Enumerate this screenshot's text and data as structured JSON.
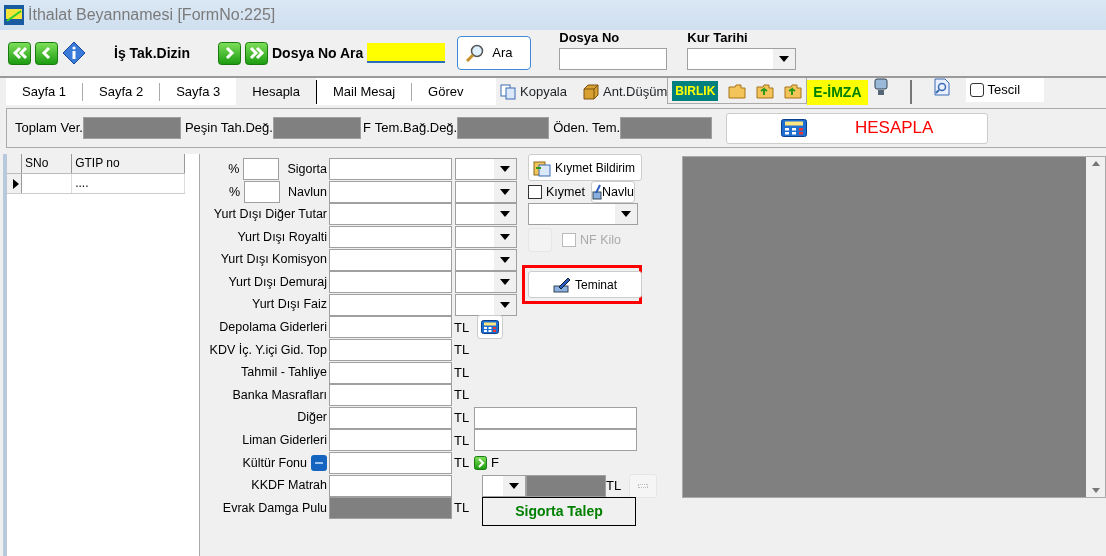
{
  "window": {
    "title": "İthalat Beyannamesi [FormNo:225]"
  },
  "toolbar": {
    "index_label": "İş Tak.Dizin",
    "search_label": "Dosya No Ara",
    "search_field": {
      "highlighted": true
    },
    "search_button": "Ara",
    "file_no_label": "Dosya No",
    "rate_date_label": "Kur Tarihi"
  },
  "tabs": [
    {
      "label": "Sayfa 1",
      "selected": false
    },
    {
      "label": "Sayfa 2",
      "selected": false
    },
    {
      "label": "Sayfa 3",
      "selected": false
    },
    {
      "label": "Hesapla",
      "selected": true
    },
    {
      "label": "Mail Mesaj",
      "selected": false
    },
    {
      "label": "Görev",
      "selected": false
    }
  ],
  "tools": {
    "copy": "Kopyala",
    "deduction": "Ant.Düşüm",
    "birlik": "BIRLIK",
    "esign": "E-İMZA",
    "register": {
      "label": "Tescil",
      "checked": false
    }
  },
  "summary": {
    "fields": [
      {
        "label": "Toplam Ver.",
        "disabled": true
      },
      {
        "label": "Peşin Tah.Değ.",
        "disabled": true,
        "suffix": "F"
      },
      {
        "label": "Tem.Bağ.Değ.",
        "disabled": true
      },
      {
        "label": "Öden. Tem.",
        "disabled": true
      }
    ],
    "calc_button": "HESAPLA"
  },
  "grid": {
    "columns": [
      "SNo",
      "GTIP no"
    ],
    "rows": [
      {
        "current": true,
        "cells": [
          "",
          "...."
        ]
      }
    ]
  },
  "form": {
    "top_rows": [
      {
        "label": "Sigorta",
        "prefix": "%"
      },
      {
        "label": "Navlun",
        "prefix": "%"
      },
      {
        "label": "Yurt Dışı Diğer Tutar"
      },
      {
        "label": "Yurt Dışı Royalti"
      },
      {
        "label": "Yurt Dışı Komisyon"
      },
      {
        "label": "Yurt Dışı Demuraj"
      },
      {
        "label": "Yurt Dışı Faiz"
      }
    ],
    "side": [
      {
        "kind": "button",
        "label": "Kıymet Bildirim"
      },
      {
        "kind": "check",
        "label": "Kıymet",
        "checked": false,
        "disabled": false,
        "button": "Navlu"
      },
      {
        "kind": "select"
      },
      {
        "kind": "check",
        "label": "NF Kilo",
        "checked": false,
        "disabled": true
      },
      {
        "kind": "button",
        "label": "Teminat",
        "highlighted": true
      }
    ],
    "rows": [
      {
        "label": "Depolama Giderleri",
        "unit": "TL",
        "disabled": false,
        "extra": {
          "kind": "calc"
        }
      },
      {
        "label": "KDV İç. Y.içi Gid. Top",
        "unit": "TL",
        "disabled": false
      },
      {
        "label": "Tahmil - Tahliye",
        "unit": "TL",
        "disabled": false
      },
      {
        "label": "Banka Masrafları",
        "unit": "TL",
        "disabled": false
      },
      {
        "label": "Diğer",
        "unit": "TL",
        "disabled": false,
        "extra": {
          "kind": "field"
        }
      },
      {
        "label": "Liman Giderleri",
        "unit": "TL",
        "disabled": false,
        "extra": {
          "kind": "field"
        }
      },
      {
        "label": "Kültür Fonu",
        "unit": "TL",
        "disabled": false,
        "minus_button": true,
        "extra": {
          "kind": "arrow",
          "text": "F"
        }
      },
      {
        "label": "KKDF Matrah",
        "disabled": false,
        "extra": {
          "kind": "kkdf",
          "unit": "TL"
        }
      },
      {
        "label": "Evrak Damga Pulu",
        "unit": "TL",
        "disabled": true,
        "extra": {
          "kind": "button",
          "label": "Sigorta Talep"
        }
      }
    ]
  }
}
